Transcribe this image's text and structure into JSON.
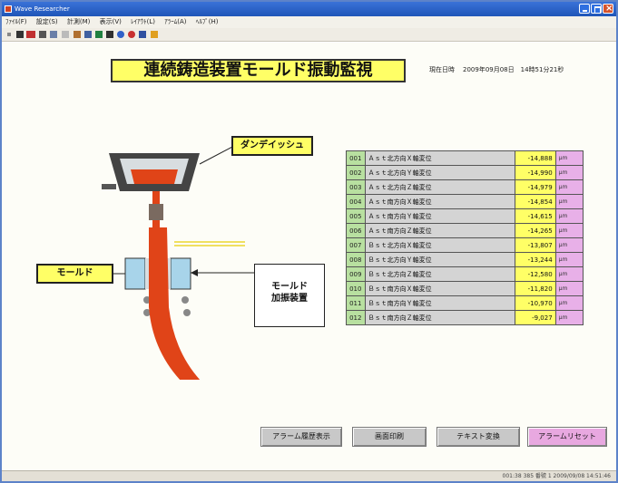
{
  "window": {
    "title": "Wave Researcher"
  },
  "menu": [
    "ﾌｧｲﾙ(F)",
    "設定(S)",
    "計測(M)",
    "表示(V)",
    "ﾚｲｱｳﾄ(L)",
    "ｱﾗｰﾑ(A)",
    "ﾍﾙﾌﾟ(H)"
  ],
  "screen": {
    "title": "連続鋳造装置モールド振動監視",
    "clock_label": "現在日時",
    "clock_value": "2009年09月08日　14時51分21秒"
  },
  "diagram": {
    "tundish_label": "ダンデイッシュ",
    "mold_label": "モールド",
    "oscillator_label_line1": "モールド",
    "oscillator_label_line2": "加振装置"
  },
  "table": {
    "unit": "μm",
    "rows": [
      {
        "no": "001",
        "name": "Ａｓｔ北方向Ｘ軸変位",
        "value": "-14,888"
      },
      {
        "no": "002",
        "name": "Ａｓｔ北方向Ｙ軸変位",
        "value": "-14,990"
      },
      {
        "no": "003",
        "name": "Ａｓｔ北方向Ｚ軸変位",
        "value": "-14,979"
      },
      {
        "no": "004",
        "name": "Ａｓｔ南方向Ｘ軸変位",
        "value": "-14,854"
      },
      {
        "no": "005",
        "name": "Ａｓｔ南方向Ｙ軸変位",
        "value": "-14,615"
      },
      {
        "no": "006",
        "name": "Ａｓｔ南方向Ｚ軸変位",
        "value": "-14,265"
      },
      {
        "no": "007",
        "name": "Ｂｓｔ北方向Ｘ軸変位",
        "value": "-13,807"
      },
      {
        "no": "008",
        "name": "Ｂｓｔ北方向Ｙ軸変位",
        "value": "-13,244"
      },
      {
        "no": "009",
        "name": "Ｂｓｔ北方向Ｚ軸変位",
        "value": "-12,580"
      },
      {
        "no": "010",
        "name": "Ｂｓｔ南方向Ｘ軸変位",
        "value": "-11,820"
      },
      {
        "no": "011",
        "name": "Ｂｓｔ南方向Ｙ軸変位",
        "value": "-10,970"
      },
      {
        "no": "012",
        "name": "Ｂｓｔ南方向Ｚ軸変位",
        "value": "-9,027"
      }
    ]
  },
  "buttons": {
    "alarm_history": "アラーム履歴表示",
    "print": "画面印刷",
    "text_convert": "テキスト変換",
    "alarm_reset": "アラームリセット"
  },
  "status": {
    "text": "001:38 385 番號 1 2009/09/08 14:51:46"
  },
  "colors": {
    "title_bg": "#ffff66",
    "no_cell": "#b8e0a0",
    "name_cell": "#d4d4d4",
    "value_cell": "#ffff66",
    "unit_cell": "#e8b0e8",
    "steel": "#e04418"
  },
  "icons": [
    "app-icon",
    "minimize-icon",
    "maximize-icon",
    "close-icon"
  ]
}
